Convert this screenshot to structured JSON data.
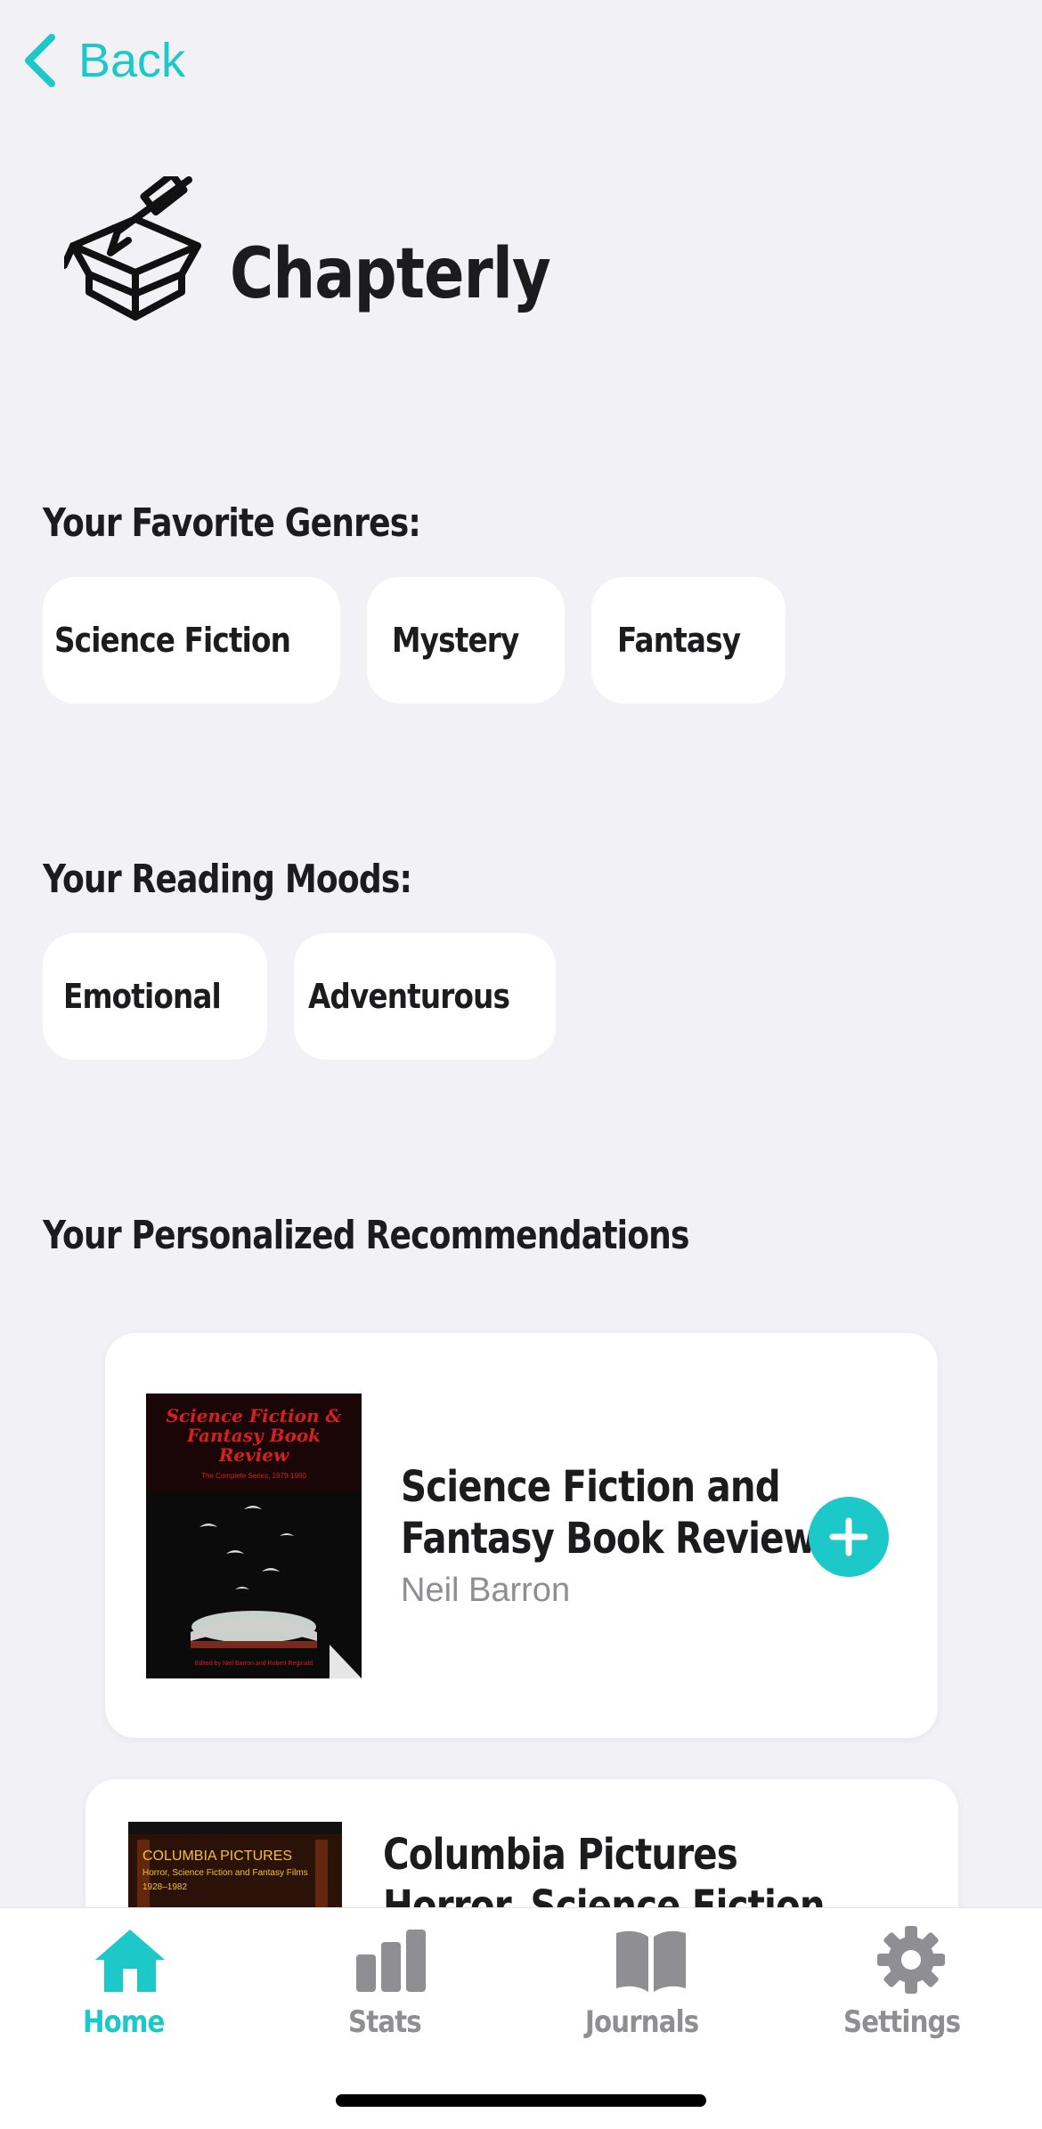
{
  "nav": {
    "back_label": "Back"
  },
  "app": {
    "title": "Chapterly"
  },
  "genres": {
    "heading": "Your Favorite Genres:",
    "items": [
      "Science Fiction",
      "Mystery",
      "Fantasy"
    ]
  },
  "moods": {
    "heading": "Your Reading Moods:",
    "items": [
      "Emotional",
      "Adventurous"
    ]
  },
  "recommendations": {
    "heading": "Your Personalized Recommendations",
    "books": [
      {
        "title_line1": "Science Fiction and",
        "title_line2": "Fantasy Book Review",
        "author": "Neil Barron",
        "cover_text": "Science Fiction & Fantasy Book Review",
        "cover_sub": "The Complete Series, 1979-1980",
        "cover_credit": "Edited by Neil Barron and Robert Reginald"
      },
      {
        "title_line1": "Columbia Pictures",
        "title_line2": "Horror, Science Fiction",
        "cover_text": "COLUMBIA PICTURES",
        "cover_sub": "Horror, Science Fiction and Fantasy Films",
        "cover_year": "1928–1982"
      }
    ]
  },
  "tabs": [
    {
      "label": "Home",
      "icon": "house-icon",
      "active": true
    },
    {
      "label": "Stats",
      "icon": "bar-chart-icon",
      "active": false
    },
    {
      "label": "Journals",
      "icon": "book-open-icon",
      "active": false
    },
    {
      "label": "Settings",
      "icon": "gear-icon",
      "active": false
    }
  ],
  "colors": {
    "accent": "#1cc8c8",
    "background": "#f1f1f6",
    "inactive_tab": "#8e8e93"
  }
}
